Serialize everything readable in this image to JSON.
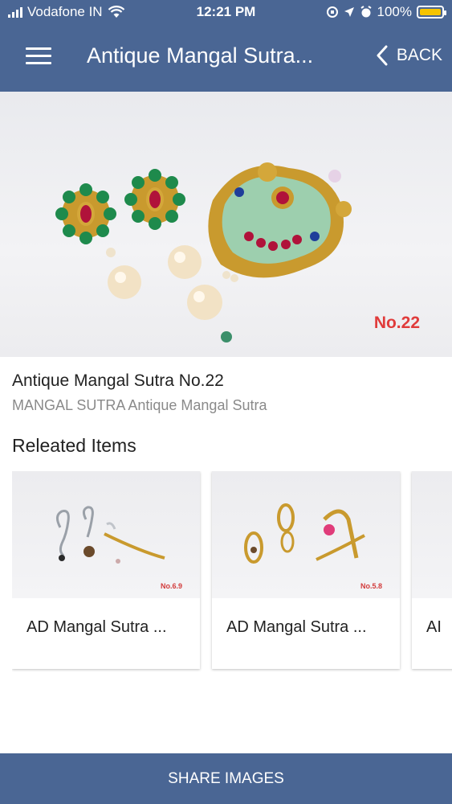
{
  "status_bar": {
    "carrier": "Vodafone IN",
    "time": "12:21 PM",
    "battery": "100%"
  },
  "header": {
    "title": "Antique Mangal Sutra...",
    "back_label": "BACK"
  },
  "hero": {
    "image_label": "No.22",
    "active_page": 1,
    "page_count": 1
  },
  "product": {
    "title": "Antique Mangal Sutra No.22",
    "subtitle": "MANGAL SUTRA Antique Mangal Sutra"
  },
  "related": {
    "heading": "Releated Items",
    "items": [
      {
        "name": "AD Mangal Sutra ...",
        "image_label": "No.6.9"
      },
      {
        "name": "AD Mangal Sutra ...",
        "image_label": "No.5.8"
      },
      {
        "name": "AI",
        "image_label": ""
      }
    ]
  },
  "footer": {
    "share_label": "SHARE IMAGES"
  },
  "colors": {
    "app_bar": "#4a6694",
    "label_red": "#e03b3b",
    "pager_dot": "#3b8f6a"
  }
}
